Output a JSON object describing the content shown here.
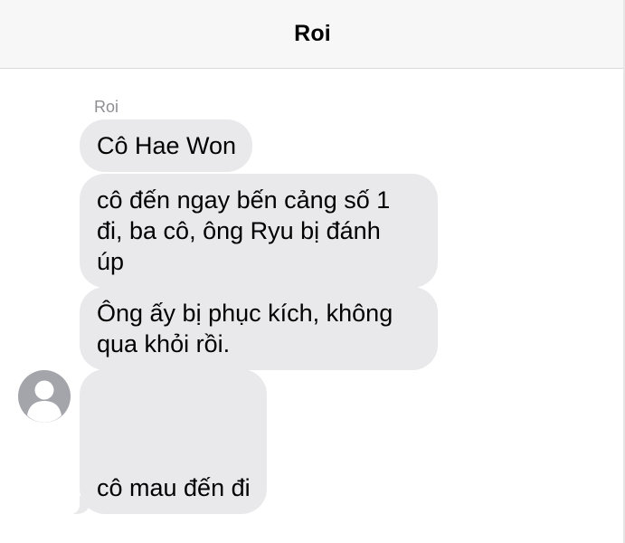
{
  "header": {
    "title": "Roi"
  },
  "thread": {
    "sender_name": "Roi",
    "messages": [
      {
        "text": "Cô Hae Won"
      },
      {
        "text": "cô đến ngay bến cảng số 1\nđi, ba cô, ông Ryu bị đánh\núp"
      },
      {
        "text": "Ông ấy bị phục kích, không\nqua khỏi rồi."
      },
      {
        "text": "cô mau đến đi"
      }
    ],
    "avatar_icon": "person-placeholder-icon"
  },
  "colors": {
    "header_bg": "#f7f7f8",
    "bubble_bg": "#e9e9eb",
    "avatar_bg": "#a3a5ab",
    "sender_text": "#8e8e93"
  }
}
